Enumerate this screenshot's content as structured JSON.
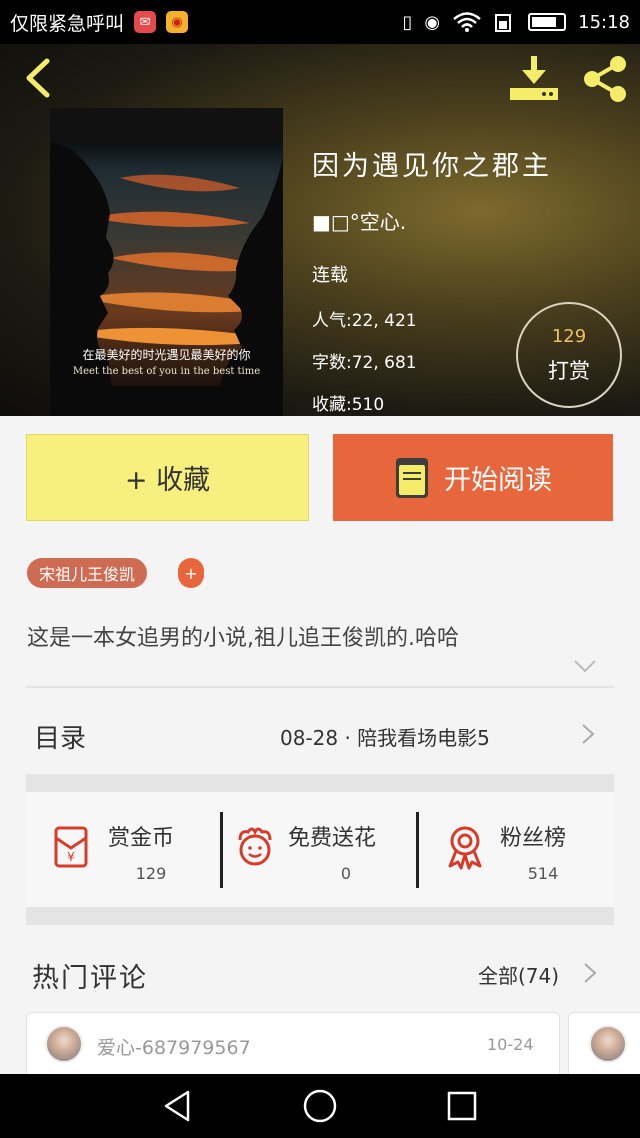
{
  "status_bar": {
    "carrier": "仅限紧急呼叫",
    "time": "15:18"
  },
  "book": {
    "title": "因为遇见你之郡主",
    "author": "■□°空心.",
    "status": "连载",
    "popularity": "人气:22, 421",
    "word_count": "字数:72, 681",
    "favorites": "收藏:510",
    "reward_count": "129",
    "reward_label": "打赏",
    "cover_caption_cn": "在最美好的时光遇见最美好的你",
    "cover_caption_en": "Meet the best of you in the best time"
  },
  "actions": {
    "collect_label": "+ 收藏",
    "read_label": "开始阅读"
  },
  "tags": [
    {
      "label": "宋祖儿王俊凯"
    }
  ],
  "tag_add_label": "+",
  "description": "这是一本女追男的小说,祖儿追王俊凯的.哈哈",
  "toc": {
    "label": "目录",
    "latest": "08-28 · 陪我看场电影5"
  },
  "stats": [
    {
      "label": "赏金币",
      "count": "129",
      "icon": "red-envelope-icon"
    },
    {
      "label": "免费送花",
      "count": "0",
      "icon": "flower-icon"
    },
    {
      "label": "粉丝榜",
      "count": "514",
      "icon": "medal-icon"
    }
  ],
  "comments_section": {
    "title": "热门评论",
    "see_all": "全部(74)",
    "items": [
      {
        "user": "爱心-687979567",
        "date": "10-24"
      }
    ]
  },
  "colors": {
    "accent_orange": "#e8663c",
    "collect_yellow": "#f8f07e",
    "reward_gold": "#f1c15a",
    "tag_red": "#cd6b53"
  }
}
